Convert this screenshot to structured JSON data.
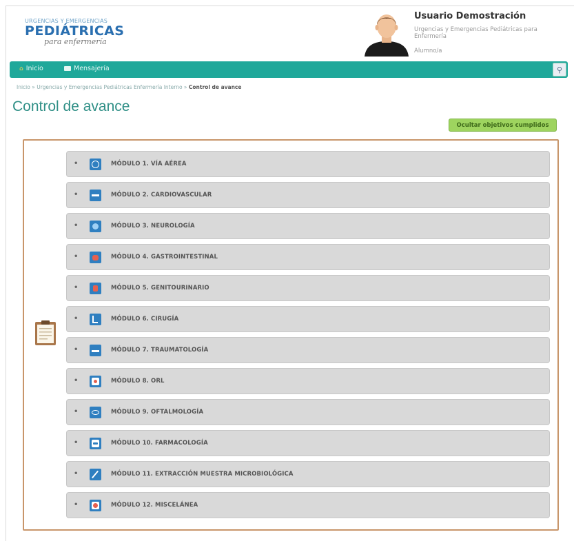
{
  "header": {
    "logo": {
      "small": "URGENCIAS Y EMERGENCIAS",
      "big": "PEDIÁTRICAS",
      "script": "para enfermería"
    },
    "user": {
      "name": "Usuario Demostración",
      "course": "Urgencias y Emergencias Pediátricas para Enfermería",
      "role": "Alumno/a"
    }
  },
  "navbar": {
    "home_label": "Inicio",
    "messages_label": "Mensajería",
    "icons": [
      "home-icon",
      "mail-icon",
      "wrench-icon"
    ],
    "color": "#1fa89a"
  },
  "breadcrumb": {
    "path": "Inicio » Urgencias y Emergencias Pediátricas Enfermería Interno » ",
    "current": "Control de avance"
  },
  "page": {
    "title": "Control de avance",
    "hide_button": "Ocultar objetivos cumplidos"
  },
  "modules": [
    {
      "bullet": "•",
      "label": "MÓDULO 1. VÍA AÉREA",
      "icon": "airway-icon"
    },
    {
      "bullet": "•",
      "label": "MÓDULO 2. CARDIOVASCULAR",
      "icon": "cardio-icon"
    },
    {
      "bullet": "•",
      "label": "MÓDULO 3. NEUROLOGÍA",
      "icon": "neuro-icon"
    },
    {
      "bullet": "•",
      "label": "MÓDULO 4. GASTROINTESTINAL",
      "icon": "gastro-icon"
    },
    {
      "bullet": "•",
      "label": "MÓDULO 5. GENITOURINARIO",
      "icon": "genito-icon"
    },
    {
      "bullet": "•",
      "label": "MÓDULO 6. CIRUGÍA",
      "icon": "surgery-icon"
    },
    {
      "bullet": "•",
      "label": "MÓDULO 7. TRAUMATOLOGÍA",
      "icon": "trauma-icon"
    },
    {
      "bullet": "•",
      "label": "MÓDULO 8. ORL",
      "icon": "orl-icon"
    },
    {
      "bullet": "•",
      "label": "MÓDULO 9. OFTALMOLOGÍA",
      "icon": "eye-icon"
    },
    {
      "bullet": "•",
      "label": "MÓDULO 10. FARMACOLOGÍA",
      "icon": "pharma-icon"
    },
    {
      "bullet": "•",
      "label": "MÓDULO 11. EXTRACCIÓN MUESTRA MICROBIOLÓGICA",
      "icon": "sample-icon"
    },
    {
      "bullet": "•",
      "label": "MÓDULO 12. MISCELÁNEA",
      "icon": "misc-icon"
    }
  ]
}
